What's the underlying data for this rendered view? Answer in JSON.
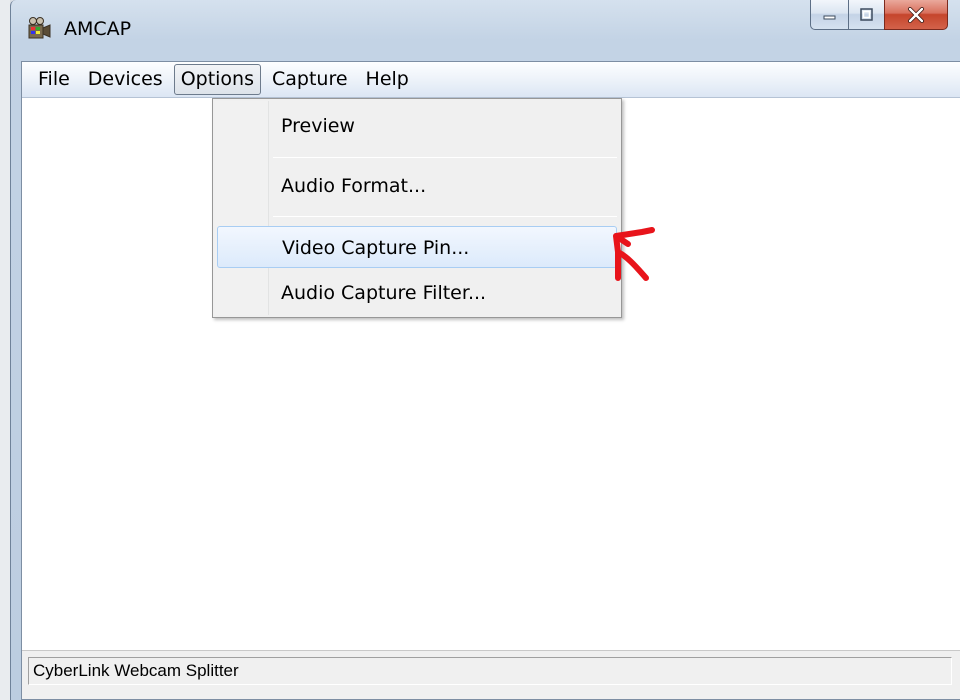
{
  "window": {
    "title": "AMCAP",
    "controls": {
      "minimize": "minimize",
      "maximize": "maximize",
      "close": "close"
    }
  },
  "menubar": {
    "items": [
      "File",
      "Devices",
      "Options",
      "Capture",
      "Help"
    ],
    "open_item": "Options"
  },
  "options_menu": {
    "items": [
      "Preview",
      "Audio Format...",
      "Video Capture Pin...",
      "Audio Capture Filter..."
    ],
    "highlighted": "Video Capture Pin..."
  },
  "statusbar": {
    "text": "CyberLink Webcam Splitter"
  },
  "annotation": {
    "type": "hand-drawn-arrow",
    "color": "#e8141b"
  },
  "colors": {
    "highlight_border": "#a8cdf3",
    "close_button": "#c5452c"
  }
}
